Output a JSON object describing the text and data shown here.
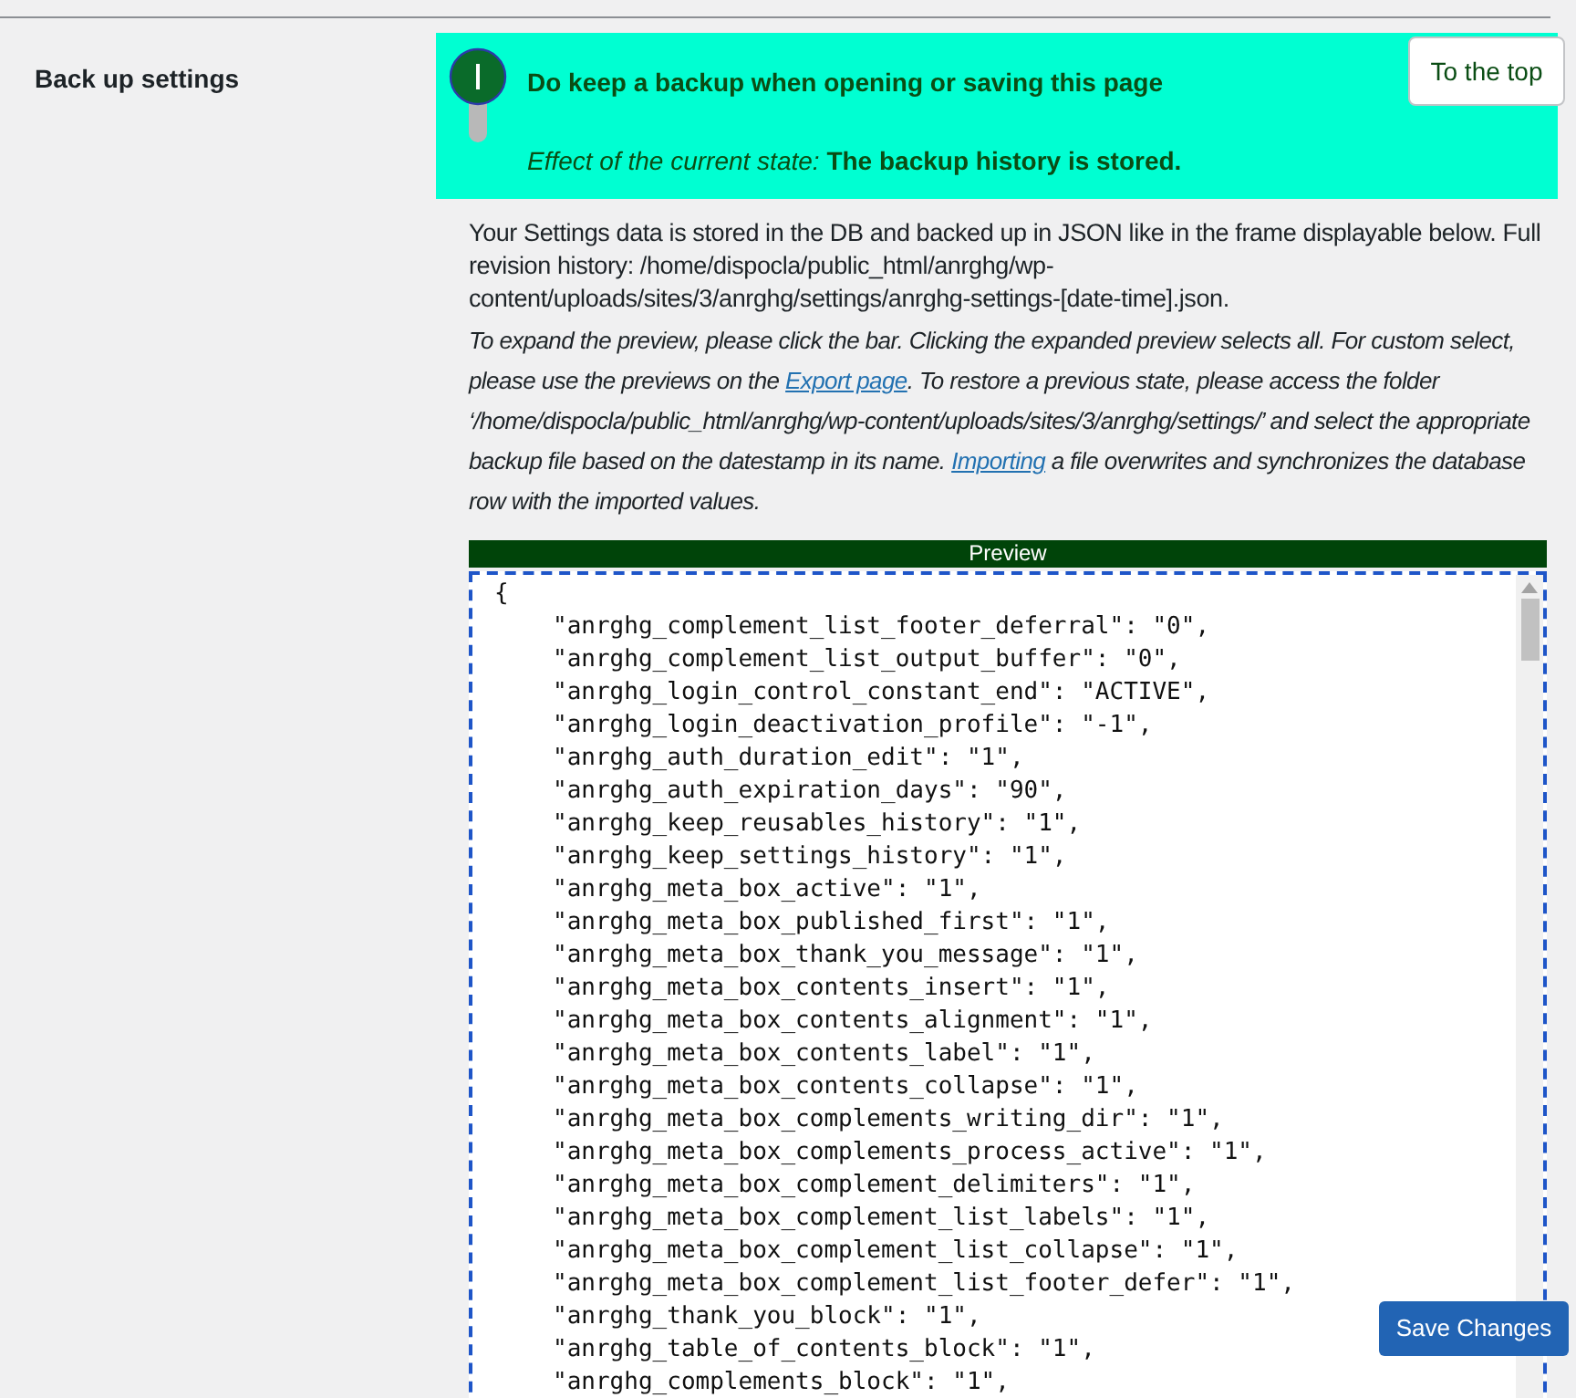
{
  "section": {
    "label": "Back up settings"
  },
  "backup_option": {
    "on": true,
    "title": "Do keep a backup when opening or saving this page",
    "effect": "*Effect of the current state:* **The backup history is stored.**"
  },
  "to_top_button": "To the top",
  "description": "Your Settings data is stored in the DB and backed up in JSON like in the frame displayable below. Full revision history: /home/dispocla/public_html/anrghg/wp-content/uploads/sites/3/anrghg/settings/anrghg-settings-[date-time].json.",
  "instructions": [
    {
      "kind": "text",
      "text": "To expand the preview, please click the bar. Clicking the expanded preview selects all. For custom select, please use the previews on the "
    },
    {
      "kind": "link",
      "text": "Export page"
    },
    {
      "kind": "text",
      "text": ". To restore a previous state, please access the folder ‘/home/dispocla/public_html/anrghg/wp-content/uploads/sites/3/anrghg/settings/’ and select the appropriate backup file based on the datestamp in its name. "
    },
    {
      "kind": "link",
      "text": "Importing"
    },
    {
      "kind": "text",
      "text": " a file overwrites and synchronizes the database row with the imported values."
    }
  ],
  "preview": {
    "bar": "Preview",
    "open": "{",
    "entries": [
      "\"anrghg_complement_list_footer_deferral\": \"0\",",
      "\"anrghg_complement_list_output_buffer\": \"0\",",
      "\"anrghg_login_control_constant_end\": \"ACTIVE\",",
      "\"anrghg_login_deactivation_profile\": \"-1\",",
      "\"anrghg_auth_duration_edit\": \"1\",",
      "\"anrghg_auth_expiration_days\": \"90\",",
      "\"anrghg_keep_reusables_history\": \"1\",",
      "\"anrghg_keep_settings_history\": \"1\",",
      "\"anrghg_meta_box_active\": \"1\",",
      "\"anrghg_meta_box_published_first\": \"1\",",
      "\"anrghg_meta_box_thank_you_message\": \"1\",",
      "\"anrghg_meta_box_contents_insert\": \"1\",",
      "\"anrghg_meta_box_contents_alignment\": \"1\",",
      "\"anrghg_meta_box_contents_label\": \"1\",",
      "\"anrghg_meta_box_contents_collapse\": \"1\",",
      "\"anrghg_meta_box_complements_writing_dir\": \"1\",",
      "\"anrghg_meta_box_complements_process_active\": \"1\",",
      "\"anrghg_meta_box_complement_delimiters\": \"1\",",
      "\"anrghg_meta_box_complement_list_labels\": \"1\",",
      "\"anrghg_meta_box_complement_list_collapse\": \"1\",",
      "\"anrghg_meta_box_complement_list_footer_defer\": \"1\",",
      "\"anrghg_thank_you_block\": \"1\",",
      "\"anrghg_table_of_contents_block\": \"1\",",
      "\"anrghg_complements_block\": \"1\","
    ]
  },
  "save_button": "Save Changes"
}
